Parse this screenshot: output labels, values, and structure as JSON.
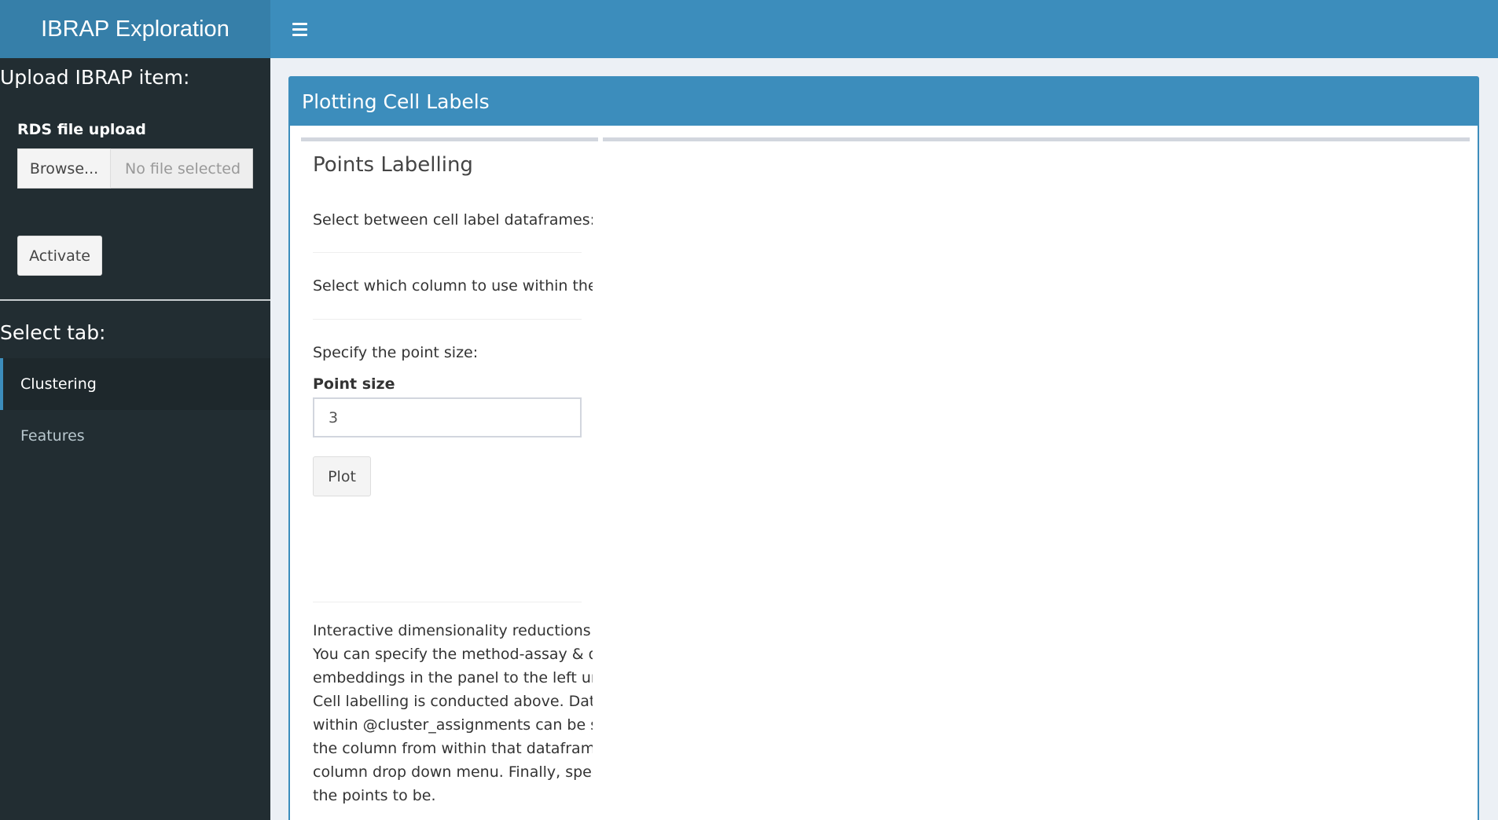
{
  "header": {
    "app_title": "IBRAP Exploration",
    "menu_icon": "hamburger-icon"
  },
  "sidebar": {
    "upload_heading": "Upload IBRAP item:",
    "upload_label": "RDS file upload",
    "browse_label": "Browse...",
    "file_placeholder": "No file selected",
    "activate_label": "Activate",
    "tab_heading": "Select tab:",
    "items": [
      {
        "label": "Clustering",
        "active": true
      },
      {
        "label": "Features",
        "active": false
      }
    ]
  },
  "main": {
    "box_title": "Plotting Cell Labels",
    "panel_title": "Points Labelling",
    "select_df_text": "Select between cell label dataframes:",
    "select_col_text": "Select which column to use within the dataframe:",
    "point_size_text": "Specify the point size:",
    "point_size_label": "Point size",
    "point_size_value": "3",
    "plot_button": "Plot",
    "description_lines": [
      "Interactive dimensionality reductions plot.",
      "You can specify the method-assay & dimensionality",
      "embeddings in the panel to the left under",
      "Cell labelling is conducted above. Dataframes",
      "within @cluster_assignments can be selected and",
      "the column from within that dataframe using the",
      "column drop down menu. Finally, specify the size of",
      "the points to be."
    ]
  },
  "colors": {
    "header_blue": "#3c8dbc",
    "brand_blue": "#367fa9",
    "sidebar_dark": "#222d32",
    "content_bg": "#ecf0f5"
  }
}
